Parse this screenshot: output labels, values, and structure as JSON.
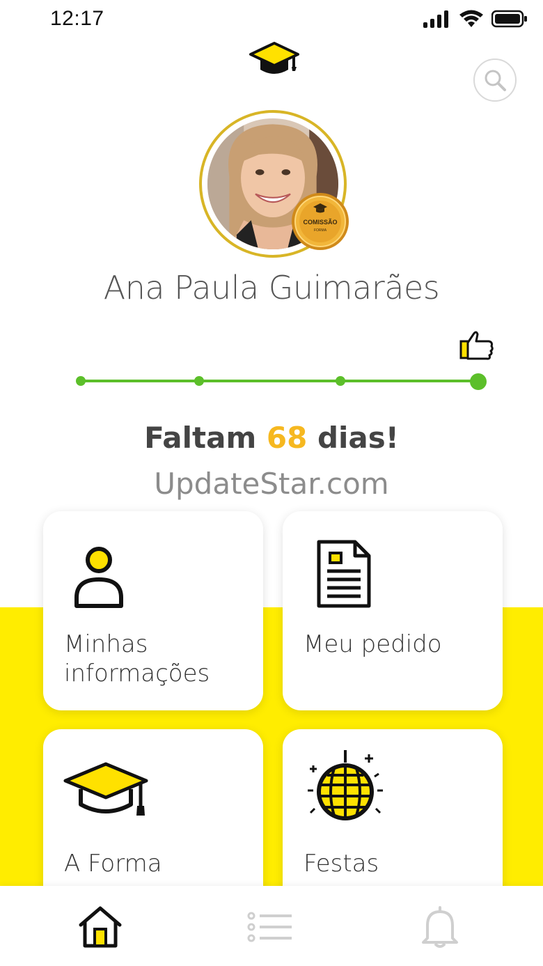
{
  "status_bar": {
    "time": "12:17"
  },
  "profile": {
    "name": "Ana Paula Guimarães",
    "badge_text": "COMISSÃO",
    "badge_subtext": "FORMA"
  },
  "progress": {
    "steps_total": 4,
    "current_step": 4
  },
  "countdown": {
    "prefix": "Faltam",
    "days": "68",
    "suffix": "dias!"
  },
  "watermark": "UpdateStar.com",
  "cards": [
    {
      "label": "Minhas informações",
      "icon": "person-icon"
    },
    {
      "label": "Meu pedido",
      "icon": "document-icon"
    },
    {
      "label": "A Forma",
      "icon": "graduation-cap-icon"
    },
    {
      "label": "Festas",
      "icon": "disco-ball-icon"
    }
  ],
  "tabs": [
    {
      "name": "home",
      "icon": "home-icon",
      "active": true
    },
    {
      "name": "list",
      "icon": "list-icon",
      "active": false
    },
    {
      "name": "notifications",
      "icon": "bell-icon",
      "active": false
    }
  ],
  "colors": {
    "accent_yellow": "#ffed00",
    "progress_green": "#5cbf2a",
    "countdown_orange": "#f6b820",
    "ring_gold": "#d8b526"
  }
}
